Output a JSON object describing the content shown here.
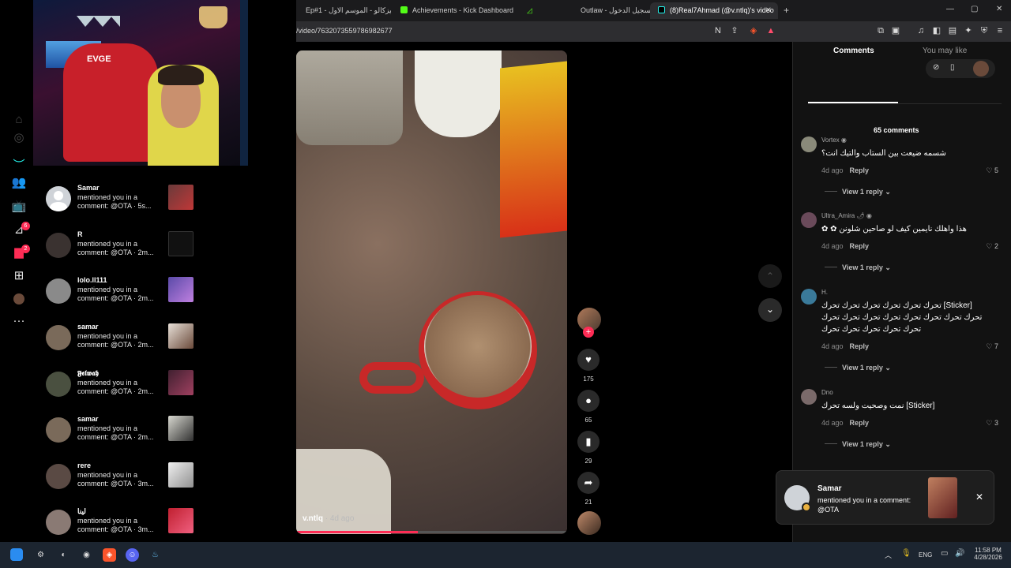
{
  "browser": {
    "tabs": [
      {
        "label": "Ep#1 - ميزكالو - الموسم الاول",
        "active": false
      },
      {
        "label": "Achievements - Kick Dashboard",
        "active": false
      },
      {
        "label": "",
        "active": false
      },
      {
        "label": "Outlaw - تسجيل الدخول",
        "active": false
      },
      {
        "label": "(8)Real7Ahmad (@v.ntlq)'s video",
        "active": true
      }
    ],
    "new_tab": "+",
    "url": "/video/7632073559786982677",
    "window_min": "—",
    "window_max": "▢",
    "window_close": "✕"
  },
  "webcam": {
    "chair_logo": "EVGE"
  },
  "nav": {
    "badge_inbox": "6",
    "badge_notifications": "2"
  },
  "notifications": [
    {
      "name": "Samar",
      "message": "mentioned you in a comment: @OTA · 5s..."
    },
    {
      "name": "R",
      "message": "mentioned you in a comment: @OTA · 2m..."
    },
    {
      "name": "lolo.ll111",
      "message": "mentioned you in a comment: @OTA · 2m..."
    },
    {
      "name": "samar",
      "message": "mentioned you in a comment: @OTA · 2m..."
    },
    {
      "name": "𝕱𝖊𝖑𝖜𝖆𝖍",
      "message": "mentioned you in a comment: @OTA · 2m..."
    },
    {
      "name": "samar",
      "message": "mentioned you in a comment: @OTA · 2m..."
    },
    {
      "name": "rere",
      "message": "mentioned you in a comment: @OTA · 3m..."
    },
    {
      "name": "لينا",
      "message": "mentioned you in a comment: @OTA · 3m..."
    }
  ],
  "video": {
    "author": "v.ntlq",
    "age": "· 4d ago",
    "progress": 0.45
  },
  "actions": {
    "likes": "175",
    "comments": "65",
    "saves": "29",
    "shares": "21"
  },
  "panel": {
    "tab_comments": "Comments",
    "tab_you_may_like": "You may like",
    "comment_count": "65 comments",
    "comments": [
      {
        "user": "Vortex ◉",
        "text": "شسمه ضيعت بين الستاب والتيك انت؟",
        "time": "4d ago",
        "reply": "Reply",
        "likes": "5",
        "view_replies": "View 1 reply"
      },
      {
        "user": "Ultra_Amira 🌶 ◉",
        "text": "هذا واهلك نايمين كيف لو صاحين شلونن ✿ ✿",
        "time": "4d ago",
        "reply": "Reply",
        "likes": "2",
        "view_replies": "View 1 reply"
      },
      {
        "user": "H.",
        "text": "[Sticker] تحرك تحرك تحرك تحرك تحرك تحرك تحرك تحرك تحرك تحرك تحرك تحرك تحرك تحرك تحرك تحرك تحرك تحرك تحرك",
        "time": "4d ago",
        "reply": "Reply",
        "likes": "7",
        "view_replies": "View 1 reply"
      },
      {
        "user": "Dno",
        "text": "[Sticker] نمت وصحيت ولسه تحرك",
        "time": "4d ago",
        "reply": "Reply",
        "likes": "3",
        "view_replies": "View 1 reply"
      }
    ]
  },
  "toast": {
    "name": "Samar",
    "message": "mentioned you in a comment: @OTA"
  },
  "taskbar": {
    "language": "ENG",
    "time": "11:58 PM",
    "date": "4/28/2026"
  },
  "colors": {
    "accent": "#fe2c55",
    "panel_bg": "#121212"
  }
}
